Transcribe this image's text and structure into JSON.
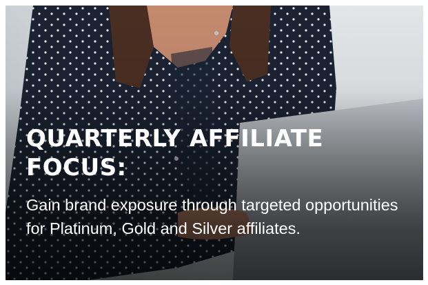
{
  "promo_card": {
    "headline": "QUARTERLY AFFILIATE FOCUS:",
    "body": "Gain brand exposure through targeted opportunities for Platinum, Gold and Silver affiliates.",
    "image_subject": "woman-polka-dot-shirt-laptop-photo",
    "colors": {
      "shirt": "#1b2333",
      "dots": "#e9ecef",
      "laptop": "#bfc4c9",
      "background": "#cfd5da",
      "text": "#ffffff"
    }
  }
}
